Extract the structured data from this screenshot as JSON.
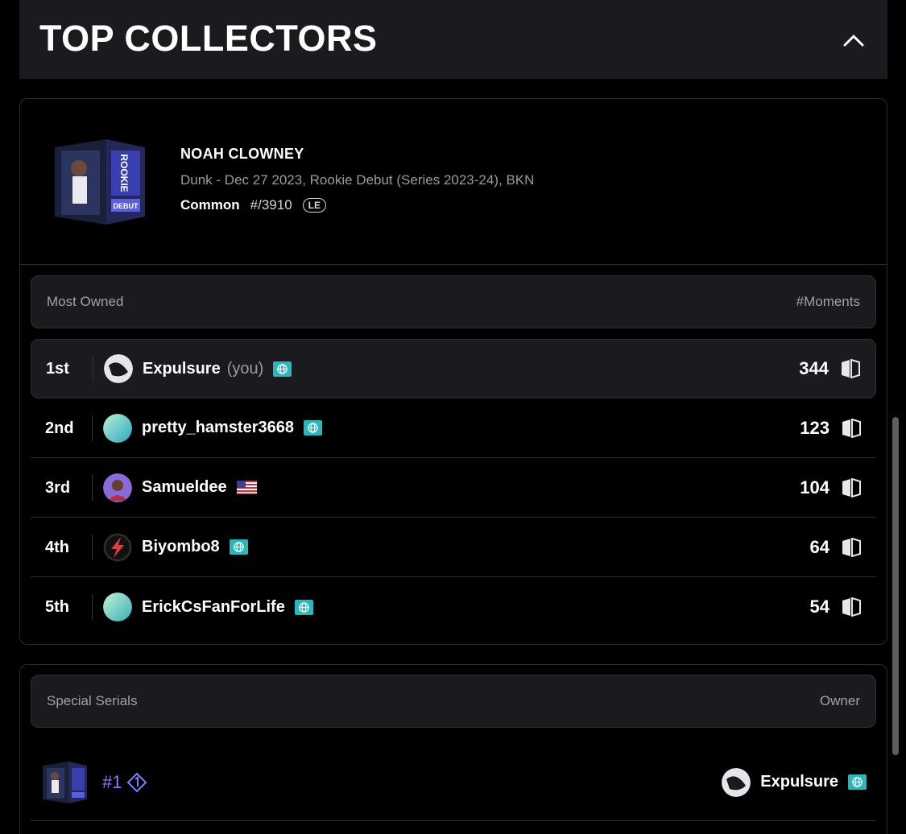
{
  "header": {
    "title": "TOP COLLECTORS",
    "collapse_icon": "chevron-up-icon"
  },
  "moment": {
    "player": "NOAH CLOWNEY",
    "details": "Dunk - Dec 27 2023, Rookie Debut (Series 2023-24), BKN",
    "tier": "Common",
    "edition_size": "#/3910",
    "badge": "LE",
    "thumbnail_text": [
      "ROOKIE",
      "DEBUT"
    ]
  },
  "most_owned": {
    "header_left": "Most Owned",
    "header_right": "#Moments",
    "rows": [
      {
        "rank": "1st",
        "name": "Expulsure",
        "you": "(you)",
        "count": "344",
        "avatar": "swirl-dark",
        "badge": "globe-icon"
      },
      {
        "rank": "2nd",
        "name": "pretty_hamster3668",
        "you": "",
        "count": "123",
        "avatar": "gradient-teal",
        "badge": "globe-icon"
      },
      {
        "rank": "3rd",
        "name": "Samueldee",
        "you": "",
        "count": "104",
        "avatar": "player-photo",
        "badge": "us-flag-icon"
      },
      {
        "rank": "4th",
        "name": "Biyombo8",
        "you": "",
        "count": "64",
        "avatar": "red-bolt",
        "badge": "globe-icon"
      },
      {
        "rank": "5th",
        "name": "ErickCsFanForLife",
        "you": "",
        "count": "54",
        "avatar": "gradient-teal",
        "badge": "globe-icon"
      }
    ]
  },
  "special_serials": {
    "header_left": "Special Serials",
    "header_right": "Owner",
    "rows": [
      {
        "serial": "#1",
        "owner": "Expulsure",
        "badge": "globe-icon"
      }
    ]
  },
  "colors": {
    "accent_teal": "#2ab6ba",
    "serial_purple": "#7e80ff",
    "panel": "#1b1b1f"
  }
}
